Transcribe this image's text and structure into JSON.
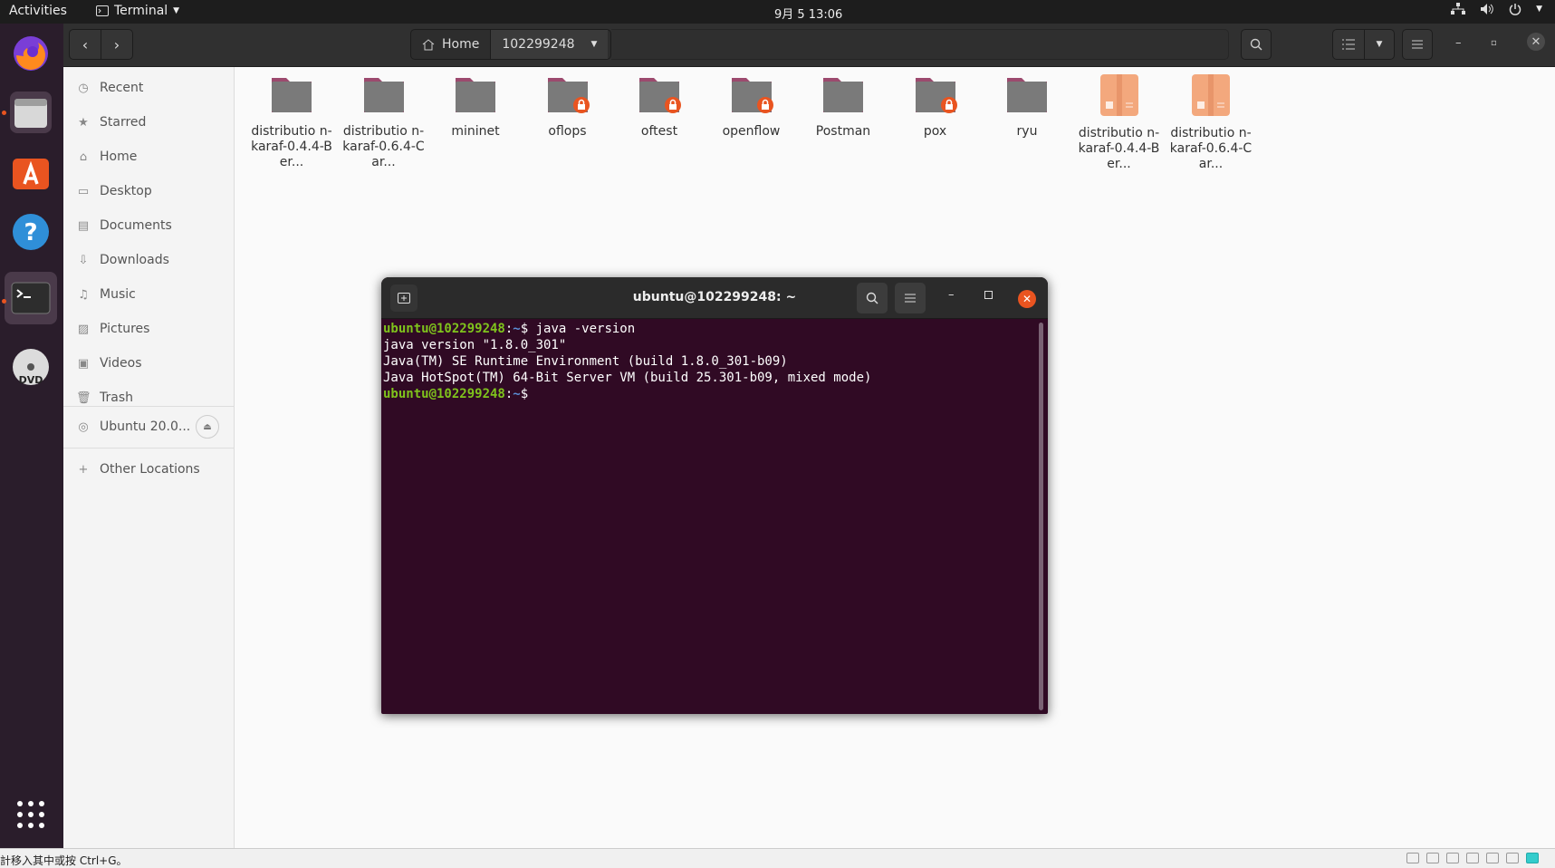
{
  "topbar": {
    "activities": "Activities",
    "app_name": "Terminal",
    "clock": "9月 5  13:06"
  },
  "dock": {
    "items": [
      {
        "name": "firefox-icon"
      },
      {
        "name": "files-icon"
      },
      {
        "name": "software-center-icon"
      },
      {
        "name": "help-icon"
      },
      {
        "name": "terminal-icon"
      },
      {
        "name": "dvd-icon"
      },
      {
        "name": "app-grid-icon"
      }
    ]
  },
  "files": {
    "pathbar": {
      "home": "Home",
      "folder": "102299248"
    },
    "sidebar": {
      "items": [
        {
          "label": "Recent",
          "icon": "clock-icon"
        },
        {
          "label": "Starred",
          "icon": "star-icon"
        },
        {
          "label": "Home",
          "icon": "home-icon"
        },
        {
          "label": "Desktop",
          "icon": "desktop-icon"
        },
        {
          "label": "Documents",
          "icon": "document-icon"
        },
        {
          "label": "Downloads",
          "icon": "download-icon"
        },
        {
          "label": "Music",
          "icon": "music-icon"
        },
        {
          "label": "Pictures",
          "icon": "picture-icon"
        },
        {
          "label": "Videos",
          "icon": "video-icon"
        },
        {
          "label": "Trash",
          "icon": "trash-icon"
        }
      ],
      "device": "Ubuntu 20.0...",
      "other": "Other Locations"
    },
    "items": [
      {
        "label": "distributio n-karaf-0.4.4-Ber...",
        "type": "folder",
        "locked": false
      },
      {
        "label": "distributio n-karaf-0.6.4-Car...",
        "type": "folder",
        "locked": false
      },
      {
        "label": "mininet",
        "type": "folder",
        "locked": false
      },
      {
        "label": "oflops",
        "type": "folder",
        "locked": true
      },
      {
        "label": "oftest",
        "type": "folder",
        "locked": true
      },
      {
        "label": "openflow",
        "type": "folder",
        "locked": true
      },
      {
        "label": "Postman",
        "type": "folder",
        "locked": false
      },
      {
        "label": "pox",
        "type": "folder",
        "locked": true
      },
      {
        "label": "ryu",
        "type": "folder",
        "locked": false
      },
      {
        "label": "distributio n-karaf-0.4.4-Ber...",
        "type": "archive",
        "locked": false
      },
      {
        "label": "distributio n-karaf-0.6.4-Car...",
        "type": "archive",
        "locked": false
      }
    ]
  },
  "terminal": {
    "title": "ubuntu@102299248: ~",
    "lines": [
      {
        "prompt": "ubuntu@102299248",
        "path": "~",
        "cmd": "java -version"
      },
      {
        "text": "java version \"1.8.0_301\""
      },
      {
        "text": "Java(TM) SE Runtime Environment (build 1.8.0_301-b09)"
      },
      {
        "text": "Java HotSpot(TM) 64-Bit Server VM (build 25.301-b09, mixed mode)"
      },
      {
        "prompt": "ubuntu@102299248",
        "path": "~",
        "cmd": ""
      }
    ]
  },
  "statusbar": {
    "message": "計移入其中或按 Ctrl+G。"
  },
  "colors": {
    "accent": "#e95420",
    "terminal_bg": "#300a24",
    "prompt_green": "#7fc31c",
    "prompt_blue": "#5b8fd6",
    "folder": "#7a7a7a",
    "folder_top": "#9c4a6e",
    "archive": "#f3a87d"
  }
}
